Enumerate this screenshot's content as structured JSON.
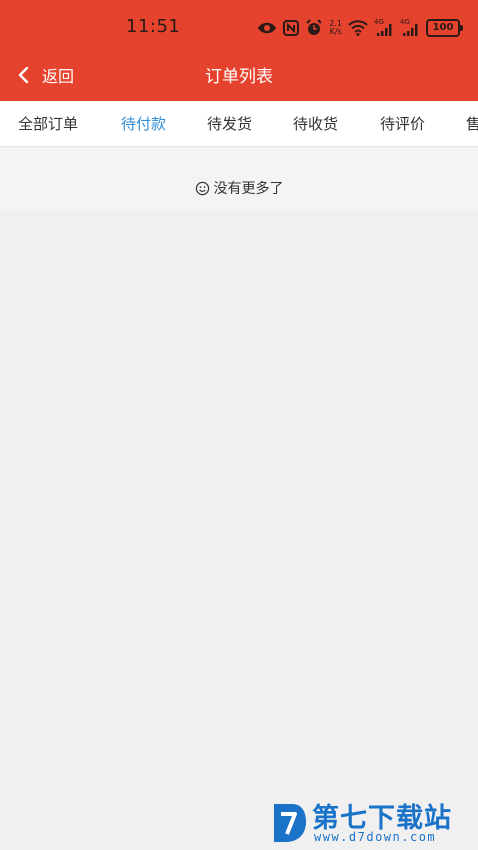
{
  "colors": {
    "header_red": "#e5432e",
    "active_tab": "#2f8ed6",
    "background": "#f0f0f0",
    "watermark_blue": "#1a73c8"
  },
  "status_bar": {
    "time": "11:51",
    "speed": "2.1",
    "speed_unit": "K/s",
    "net1": "4G",
    "net2": "4G",
    "battery": "100",
    "icons": [
      "eye-icon",
      "nfc-icon",
      "alarm-icon",
      "wifi-icon",
      "signal-icon",
      "signal-icon",
      "battery-icon"
    ]
  },
  "nav": {
    "back_label": "返回",
    "title": "订单列表"
  },
  "tabs": [
    {
      "label": "全部订单",
      "active": false
    },
    {
      "label": "待付款",
      "active": true
    },
    {
      "label": "待发货",
      "active": false
    },
    {
      "label": "待收货",
      "active": false
    },
    {
      "label": "待评价",
      "active": false
    },
    {
      "label": "售",
      "active": false
    }
  ],
  "empty_note": {
    "text": "没有更多了",
    "icon": "smiley-icon"
  },
  "watermark": {
    "text": "第七下载站",
    "url": "www.d7down.com"
  }
}
